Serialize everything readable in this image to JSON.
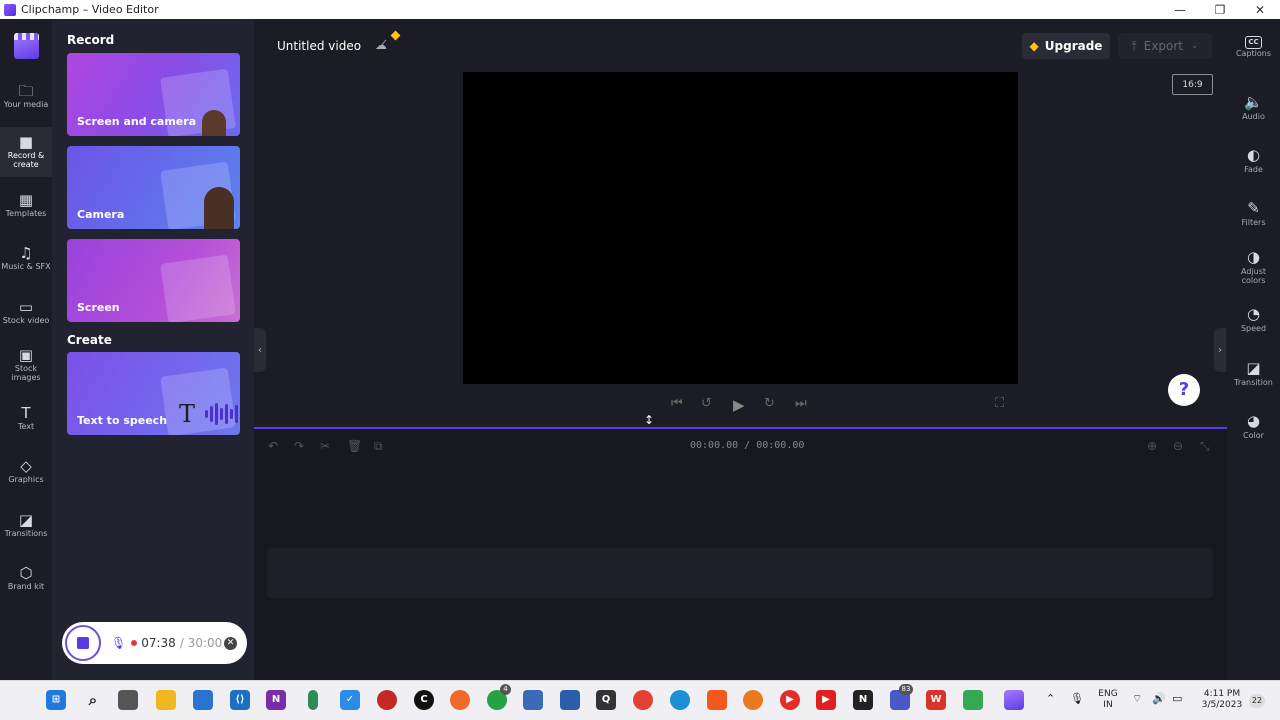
{
  "window": {
    "title": "Clipchamp – Video Editor",
    "minimize": "—",
    "maximize": "❐",
    "close": "✕"
  },
  "leftnav": {
    "items": [
      {
        "label": "Your media",
        "icon": "🗀"
      },
      {
        "label": "Record & create",
        "icon": "■"
      },
      {
        "label": "Templates",
        "icon": "▦"
      },
      {
        "label": "Music & SFX",
        "icon": "♫"
      },
      {
        "label": "Stock video",
        "icon": "▭"
      },
      {
        "label": "Stock images",
        "icon": "▣"
      },
      {
        "label": "Text",
        "icon": "T"
      },
      {
        "label": "Graphics",
        "icon": "◇"
      },
      {
        "label": "Transitions",
        "icon": "◪"
      },
      {
        "label": "Brand kit",
        "icon": "⬡"
      }
    ]
  },
  "panel": {
    "record_title": "Record",
    "create_title": "Create",
    "cards": [
      {
        "label": "Screen and camera"
      },
      {
        "label": "Camera"
      },
      {
        "label": "Screen"
      },
      {
        "label": "Text to speech"
      }
    ]
  },
  "recording": {
    "elapsed": "07:38",
    "limit": "/ 30:00"
  },
  "editor": {
    "video_title": "Untitled video",
    "upgrade_label": "Upgrade",
    "export_label": "Export",
    "aspect_ratio": "16:9"
  },
  "timeline": {
    "time": "00:00.00 / 00:00.00"
  },
  "rightbar": {
    "items": [
      {
        "label": "Captions",
        "icon": "CC"
      },
      {
        "label": "Audio",
        "icon": "🔈"
      },
      {
        "label": "Fade",
        "icon": "◐"
      },
      {
        "label": "Filters",
        "icon": "✎"
      },
      {
        "label": "Adjust colors",
        "icon": "◑"
      },
      {
        "label": "Speed",
        "icon": "◔"
      },
      {
        "label": "Transition",
        "icon": "◪"
      },
      {
        "label": "Color",
        "icon": "◕"
      }
    ]
  },
  "taskbar": {
    "lang": "ENG",
    "region": "IN",
    "time": "4:11 PM",
    "date": "3/5/2023",
    "whatsapp_badge": "4",
    "teams_badge": "83",
    "notif_count": "22"
  }
}
